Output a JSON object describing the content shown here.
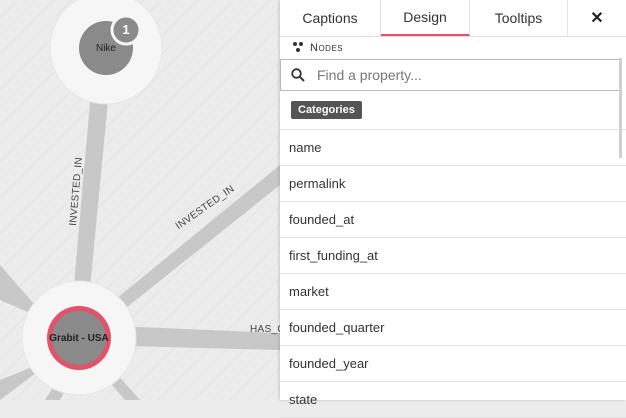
{
  "graph": {
    "nodes": [
      {
        "label": "Nike",
        "badge": "1"
      },
      {
        "label": "Grabit - USA"
      }
    ],
    "edges": [
      "INVESTED_IN",
      "INVESTED_IN",
      "HAS_C"
    ]
  },
  "panel": {
    "tabs": [
      {
        "label": "Captions",
        "active": false
      },
      {
        "label": "Design",
        "active": true
      },
      {
        "label": "Tooltips",
        "active": false
      }
    ],
    "close_label": "✕",
    "section_title": "Nodes",
    "search": {
      "placeholder": "Find a property..."
    },
    "category_badge": "Categories",
    "properties": [
      "name",
      "permalink",
      "founded_at",
      "first_funding_at",
      "market",
      "founded_quarter",
      "founded_year",
      "state"
    ]
  },
  "colors": {
    "accent": "#e0536a",
    "node": "#8a8a8a",
    "edge": "#c8c8c8"
  }
}
